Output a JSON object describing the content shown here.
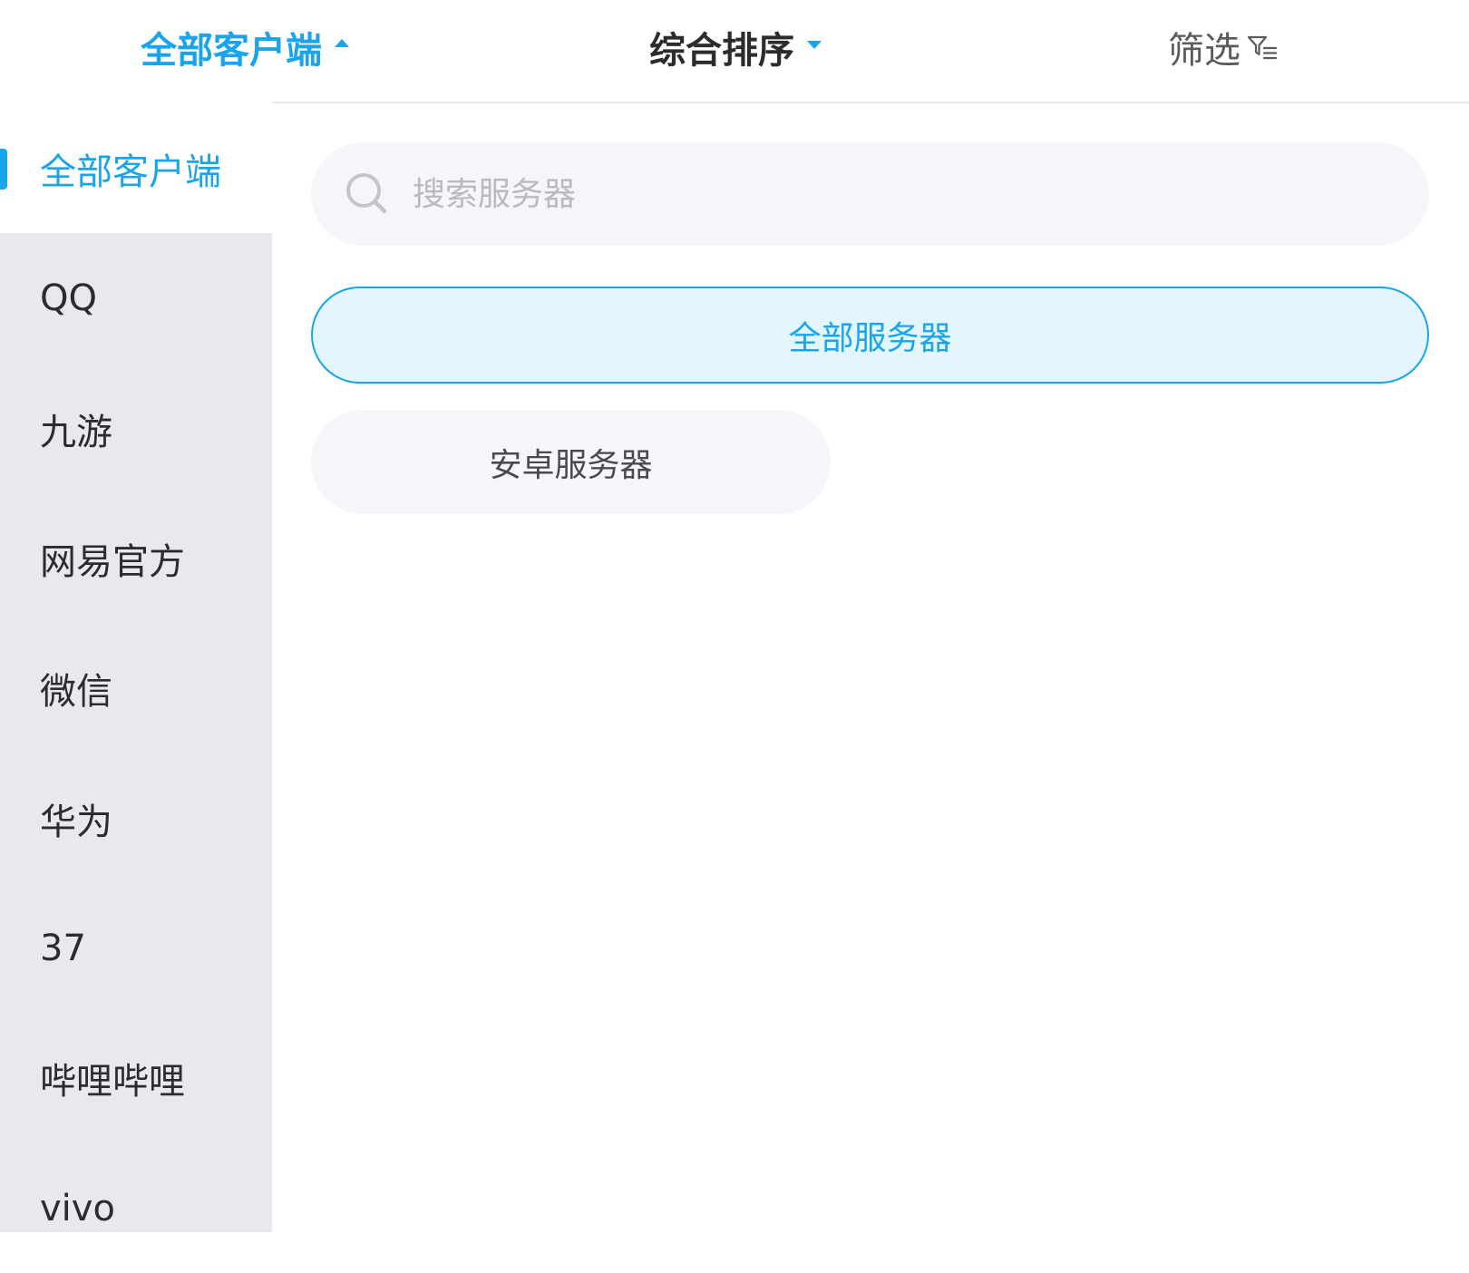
{
  "header": {
    "tabs": [
      {
        "label": "全部客户端",
        "state": "expanded"
      },
      {
        "label": "综合排序",
        "state": "collapsed"
      },
      {
        "label": "筛选",
        "icon": "filter-icon"
      }
    ]
  },
  "sidebar": {
    "items": [
      {
        "label": "全部客户端",
        "active": true
      },
      {
        "label": "QQ"
      },
      {
        "label": "九游"
      },
      {
        "label": "网易官方"
      },
      {
        "label": "微信"
      },
      {
        "label": "华为"
      },
      {
        "label": "37"
      },
      {
        "label": "哔哩哔哩"
      },
      {
        "label": "vivo"
      }
    ]
  },
  "search": {
    "placeholder": "搜索服务器",
    "value": "",
    "icon": "search-icon"
  },
  "servers": {
    "options": [
      {
        "label": "全部服务器",
        "selected": true
      },
      {
        "label": "安卓服务器",
        "selected": false
      }
    ]
  },
  "colors": {
    "accent": "#1aa4ec",
    "sidebar_bg": "#e8e9ed",
    "chip_selected_bg": "#e3f6fd",
    "chip_bg": "#f5f6f9"
  }
}
